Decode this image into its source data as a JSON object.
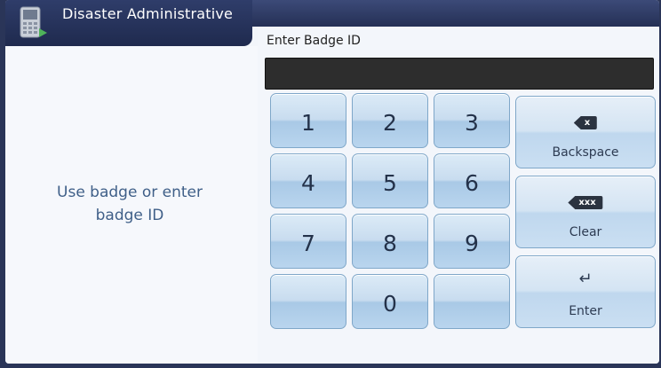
{
  "header": {
    "app_title": "Disaster Administrative",
    "app_icon": "handheld-device-icon"
  },
  "left_panel": {
    "prompt_line1": "Use badge or enter",
    "prompt_line2": "badge ID"
  },
  "badge_entry": {
    "label": "Enter Badge ID",
    "value": "",
    "placeholder": ""
  },
  "keypad": {
    "digits": [
      "1",
      "2",
      "3",
      "4",
      "5",
      "6",
      "7",
      "8",
      "9",
      "",
      "0",
      ""
    ]
  },
  "functions": {
    "backspace": {
      "icon_text": "x",
      "label": "Backspace"
    },
    "clear": {
      "icon_text": "xxx",
      "label": "Clear"
    },
    "enter": {
      "icon_glyph": "↵",
      "label": "Enter"
    }
  },
  "colors": {
    "header_bg": "#253055",
    "key_fill": "#c8dcef",
    "prompt_text": "#3f5f88"
  }
}
